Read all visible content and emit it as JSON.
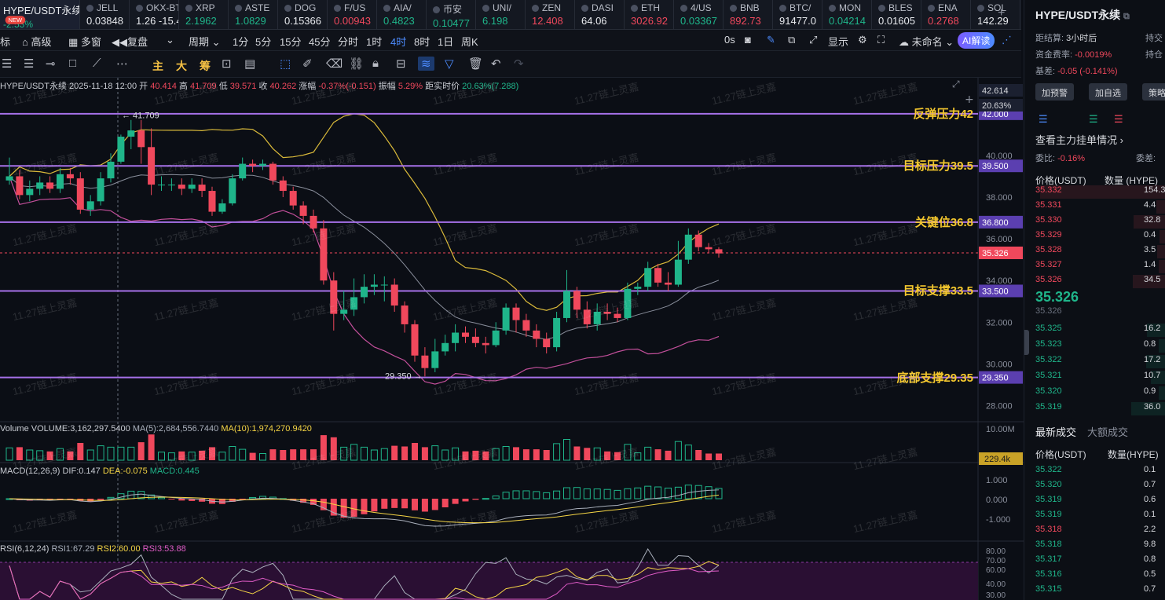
{
  "ticker": {
    "items": [
      {
        "name": "HYPE/USDT永续",
        "price": "-2.53%",
        "dir": "up",
        "badge": "NEW"
      },
      {
        "name": "JELL",
        "price": "0.03848",
        "dir": "neu"
      },
      {
        "name": "OKX-BTC",
        "price": "1.26 -15.4",
        "dir": "neu"
      },
      {
        "name": "XRP",
        "price": "2.1962",
        "dir": "up"
      },
      {
        "name": "ASTE",
        "price": "1.0829",
        "dir": "up"
      },
      {
        "name": "DOG",
        "price": "0.15366",
        "dir": "neu"
      },
      {
        "name": "F/US",
        "price": "0.00943",
        "dir": "dn"
      },
      {
        "name": "AIA/",
        "price": "0.4823",
        "dir": "up"
      },
      {
        "name": "币安",
        "price": "0.10477",
        "dir": "up"
      },
      {
        "name": "UNI/",
        "price": "6.198",
        "dir": "up"
      },
      {
        "name": "ZEN",
        "price": "12.408",
        "dir": "dn"
      },
      {
        "name": "DASI",
        "price": "64.06",
        "dir": "neu"
      },
      {
        "name": "ETH",
        "price": "3026.92",
        "dir": "dn"
      },
      {
        "name": "4/US",
        "price": "0.03367",
        "dir": "up"
      },
      {
        "name": "BNB",
        "price": "892.73",
        "dir": "dn"
      },
      {
        "name": "BTC/",
        "price": "91477.0",
        "dir": "neu"
      },
      {
        "name": "MON",
        "price": "0.04214",
        "dir": "up"
      },
      {
        "name": "BLES",
        "price": "0.01605",
        "dir": "neu"
      },
      {
        "name": "ENA",
        "price": "0.2768",
        "dir": "dn"
      },
      {
        "name": "SOL",
        "price": "142.29",
        "dir": "neu"
      }
    ],
    "add_label": "+"
  },
  "toolbar1": {
    "items": [
      "标",
      "高级",
      "多窗",
      "复盘",
      "周期",
      "1分",
      "5分",
      "15分",
      "45分",
      "分时",
      "1时",
      "4时",
      "8时",
      "1日",
      "周K"
    ],
    "active": "4时",
    "right": [
      "0s",
      "显示",
      "未命名",
      "AI解读"
    ]
  },
  "toolbar2": {
    "text_items": [
      "主",
      "大",
      "筹"
    ]
  },
  "chart_data": {
    "type": "candlestick",
    "symbol": "HYPE/USDT永续",
    "interval": "4时",
    "info": {
      "date": "2025-11-18 12:00",
      "open_label": "开",
      "open": "40.414",
      "high_label": "高",
      "high": "41.709",
      "low_label": "低",
      "low": "39.571",
      "close_label": "收",
      "close": "40.262",
      "change_label": "涨幅",
      "change": "-0.37%(-0.151)",
      "amp_label": "振幅",
      "amp": "5.29%",
      "dist_label": "距实时价",
      "dist": "20.63%(7.288)"
    },
    "price_axis": [
      "40.000",
      "38.000",
      "36.000",
      "34.000",
      "32.000",
      "30.000",
      "28.000"
    ],
    "ylim": [
      27.3,
      43.2
    ],
    "last_price": "35.326",
    "top_price": "42.614",
    "top_pct": "20.63%",
    "max_marker": "41.709",
    "min_marker": "29.350",
    "levels": [
      {
        "label": "反弹压力42",
        "price": 42.0,
        "tag": "42.000"
      },
      {
        "label": "目标压力39.5",
        "price": 39.5,
        "tag": "39.500"
      },
      {
        "label": "关键位36.8",
        "price": 36.8,
        "tag": "36.800"
      },
      {
        "label": "目标支撑33.5",
        "price": 33.5,
        "tag": "33.500"
      },
      {
        "label": "底部支撑29.35",
        "price": 29.35,
        "tag": "29.350"
      }
    ],
    "candles": [
      [
        38.8,
        39.0,
        39.9,
        38.6
      ],
      [
        39.0,
        38.1,
        39.3,
        37.9
      ],
      [
        38.1,
        38.4,
        38.8,
        37.8
      ],
      [
        38.4,
        38.7,
        39.0,
        38.1
      ],
      [
        38.7,
        38.4,
        39.0,
        38.2
      ],
      [
        38.4,
        39.1,
        39.4,
        38.2
      ],
      [
        39.1,
        38.9,
        39.4,
        38.6
      ],
      [
        38.9,
        37.4,
        39.2,
        37.2
      ],
      [
        37.4,
        37.8,
        38.1,
        37.1
      ],
      [
        37.8,
        38.9,
        39.2,
        37.6
      ],
      [
        38.9,
        39.7,
        40.1,
        38.7
      ],
      [
        39.7,
        40.9,
        41.0,
        39.6
      ],
      [
        40.9,
        41.2,
        41.7,
        40.3
      ],
      [
        41.2,
        40.4,
        41.7,
        39.6
      ],
      [
        40.4,
        38.6,
        41.3,
        38.1
      ],
      [
        38.6,
        38.6,
        39.0,
        38.3
      ],
      [
        38.6,
        38.6,
        38.9,
        38.3
      ],
      [
        38.6,
        38.4,
        38.9,
        38.1
      ],
      [
        38.4,
        38.6,
        38.9,
        38.2
      ],
      [
        38.6,
        38.3,
        38.9,
        38.0
      ],
      [
        38.3,
        37.3,
        38.5,
        37.1
      ],
      [
        37.3,
        37.7,
        37.9,
        37.2
      ],
      [
        37.7,
        38.9,
        39.1,
        37.6
      ],
      [
        38.9,
        39.6,
        39.9,
        38.8
      ],
      [
        39.6,
        39.5,
        39.8,
        39.2
      ],
      [
        39.5,
        39.6,
        39.8,
        39.3
      ],
      [
        39.6,
        38.8,
        39.7,
        38.6
      ],
      [
        38.8,
        38.3,
        39.0,
        38.0
      ],
      [
        38.3,
        37.6,
        38.5,
        37.4
      ],
      [
        37.6,
        37.1,
        37.8,
        36.7
      ],
      [
        37.1,
        36.5,
        37.4,
        36.3
      ],
      [
        36.5,
        34.0,
        36.9,
        33.8
      ],
      [
        34.0,
        32.4,
        34.4,
        31.6
      ],
      [
        32.4,
        32.6,
        33.5,
        32.1
      ],
      [
        32.6,
        33.2,
        34.1,
        32.3
      ],
      [
        33.2,
        33.7,
        34.3,
        32.9
      ],
      [
        33.7,
        33.8,
        34.3,
        33.3
      ],
      [
        33.8,
        33.8,
        34.2,
        33.0
      ],
      [
        33.8,
        32.8,
        34.1,
        32.5
      ],
      [
        32.8,
        31.9,
        33.0,
        31.5
      ],
      [
        31.9,
        30.4,
        32.1,
        30.1
      ],
      [
        30.4,
        29.8,
        30.8,
        29.4
      ],
      [
        29.8,
        30.6,
        31.2,
        29.6
      ],
      [
        30.6,
        31.0,
        31.4,
        30.4
      ],
      [
        31.0,
        31.5,
        31.9,
        30.6
      ],
      [
        31.5,
        31.3,
        31.8,
        31.0
      ],
      [
        31.3,
        31.0,
        31.7,
        30.8
      ],
      [
        31.0,
        30.9,
        31.3,
        30.5
      ],
      [
        30.9,
        31.6,
        32.0,
        30.8
      ],
      [
        31.6,
        32.7,
        32.9,
        31.4
      ],
      [
        32.7,
        32.1,
        32.9,
        31.5
      ],
      [
        32.1,
        31.6,
        32.4,
        31.3
      ],
      [
        31.6,
        31.2,
        31.9,
        30.8
      ],
      [
        31.2,
        30.8,
        31.5,
        30.5
      ],
      [
        30.8,
        32.2,
        32.5,
        30.6
      ],
      [
        32.2,
        33.5,
        34.5,
        32.0
      ],
      [
        33.5,
        32.6,
        33.7,
        32.2
      ],
      [
        32.6,
        31.9,
        33.0,
        31.7
      ],
      [
        31.9,
        32.5,
        32.9,
        31.6
      ],
      [
        32.5,
        32.4,
        32.9,
        32.1
      ],
      [
        32.4,
        32.2,
        32.7,
        32.0
      ],
      [
        32.2,
        33.6,
        33.9,
        32.1
      ],
      [
        33.6,
        33.7,
        33.9,
        33.3
      ],
      [
        33.7,
        34.6,
        34.9,
        33.5
      ],
      [
        34.6,
        33.9,
        34.8,
        33.7
      ],
      [
        33.9,
        33.8,
        34.4,
        33.5
      ],
      [
        33.8,
        35.0,
        35.9,
        33.7
      ],
      [
        35.0,
        36.2,
        36.5,
        34.8
      ],
      [
        36.2,
        35.6,
        36.4,
        35.4
      ],
      [
        35.6,
        35.5,
        35.8,
        35.3
      ],
      [
        35.5,
        35.3,
        35.6,
        35.1
      ]
    ],
    "volume": {
      "label": "Volume",
      "vol_label": "VOLUME:3,162,297.5400",
      "ma5_label": "MA(5):2,684,556.7440",
      "ma10_label": "MA(10):1,974,270.9420",
      "axis_top": "10.00M",
      "axis_tag": "229.4k"
    },
    "macd": {
      "label": "MACD(12,26,9)",
      "dif": "DIF:0.147",
      "dea": "DEA:-0.075",
      "macd": "MACD:0.445",
      "axis": [
        "1.000",
        "0.000",
        "-1.000"
      ]
    },
    "rsi": {
      "label": "RSI(6,12,24)",
      "rsi1": "RSI1:67.29",
      "rsi2": "RSI2:60.00",
      "rsi3": "RSI3:53.88",
      "axis": [
        "80.00",
        "70.00",
        "60.00",
        "40.00",
        "30.00"
      ]
    }
  },
  "watermark": "11.27链上灵嘉",
  "right_panel": {
    "title": "HYPE/USDT永续",
    "settle_label": "距结算:",
    "settle": "3小时后",
    "extra_right": "持交",
    "funding_label": "资金费率:",
    "funding": "-0.0019%",
    "hold_label": "持仓",
    "basis_label": "基差:",
    "basis": "-0.05 (-0.141%)",
    "btn_alert": "加预警",
    "btn_fav": "加自选",
    "btn_strategy": "策略",
    "main_orders": "查看主力挂单情况",
    "ratio_label": "委比:",
    "ratio": "-0.16%",
    "diff_label": "委差:",
    "col_price": "价格(USDT)",
    "col_qty": "数量 (HYPE)",
    "asks": [
      {
        "p": "35.332",
        "q": "154.3"
      },
      {
        "p": "35.331",
        "q": "4.4"
      },
      {
        "p": "35.330",
        "q": "32.8"
      },
      {
        "p": "35.329",
        "q": "0.4"
      },
      {
        "p": "35.328",
        "q": "3.5"
      },
      {
        "p": "35.327",
        "q": "1.4"
      },
      {
        "p": "35.326",
        "q": "34.5"
      }
    ],
    "mid_price": "35.326",
    "mid_sub": "35.326",
    "bids": [
      {
        "p": "35.325",
        "q": "16.2"
      },
      {
        "p": "35.323",
        "q": "0.8"
      },
      {
        "p": "35.322",
        "q": "17.2"
      },
      {
        "p": "35.321",
        "q": "10.7"
      },
      {
        "p": "35.320",
        "q": "0.9"
      },
      {
        "p": "35.319",
        "q": "36.0"
      }
    ],
    "tab_latest": "最新成交",
    "tab_large": "大额成交",
    "trades_col_price": "价格(USDT)",
    "trades_col_qty": "数量(HYPE)",
    "trades": [
      {
        "p": "35.322",
        "q": "0.1",
        "d": "up"
      },
      {
        "p": "35.320",
        "q": "0.7",
        "d": "up"
      },
      {
        "p": "35.319",
        "q": "0.6",
        "d": "up"
      },
      {
        "p": "35.319",
        "q": "0.1",
        "d": "up"
      },
      {
        "p": "35.318",
        "q": "2.2",
        "d": "dn"
      },
      {
        "p": "35.318",
        "q": "9.8",
        "d": "up"
      },
      {
        "p": "35.317",
        "q": "0.8",
        "d": "up"
      },
      {
        "p": "35.316",
        "q": "0.5",
        "d": "up"
      },
      {
        "p": "35.315",
        "q": "0.7",
        "d": "up"
      }
    ]
  },
  "colors": {
    "up": "#1fb58a",
    "down": "#f0485c",
    "level": "#a670e8",
    "label": "#f5c82e",
    "bg": "#0b0e15"
  }
}
